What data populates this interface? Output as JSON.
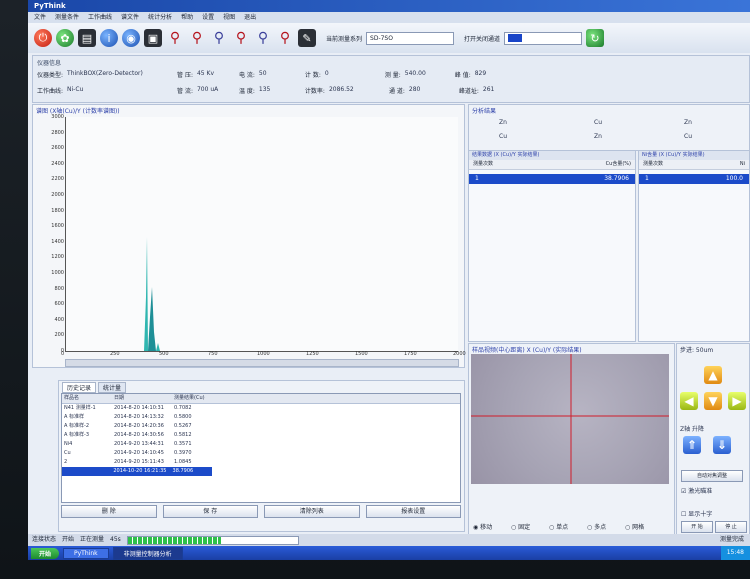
{
  "window": {
    "title": "PyThink"
  },
  "menu": [
    "文件",
    "测量条件",
    "工作曲线",
    "谱文件",
    "统计分析",
    "帮助",
    "设置",
    "视图",
    "退出"
  ],
  "toolbar": {
    "icons": [
      "power-icon",
      "gear-icon",
      "print-icon",
      "info-icon",
      "save-icon",
      "zoom-fit-icon",
      "zoom-in-icon",
      "zoom-out-icon",
      "zoom-reset-icon",
      "zoom-area-icon",
      "zoom-full-icon",
      "tool-icon"
    ],
    "measure_series_label": "当前测量系列",
    "measure_series_value": "SD-7SO",
    "open_close_label": "打开关闭通道",
    "refresh_icon": "refresh-icon"
  },
  "info": {
    "group_title": "仪器信息",
    "row1": [
      {
        "l": "仪器类型:",
        "v": "ThinkBOX(Zero-Detector)"
      },
      {
        "l": "管  压:",
        "v": "45 Kv"
      },
      {
        "l": "电  流:",
        "v": "50"
      },
      {
        "l": "计 数:",
        "v": "0"
      },
      {
        "l": "测  量:",
        "v": "540.00"
      },
      {
        "l": "峰  值:",
        "v": "829"
      }
    ],
    "row2": [
      {
        "l": "工作曲线:",
        "v": "Ni-Cu"
      },
      {
        "l": "管  流:",
        "v": "700 uA"
      },
      {
        "l": "温  度:",
        "v": "135"
      },
      {
        "l": "计数率:",
        "v": "2086.52"
      },
      {
        "l": "通  道:",
        "v": "280"
      },
      {
        "l": "峰道址:",
        "v": "261"
      }
    ]
  },
  "spectrum": {
    "caption": "谱图 (X轴(Cu)/Y (计数率谱图))",
    "yticks": [
      "3000",
      "2800",
      "2600",
      "2400",
      "2200",
      "2000",
      "1800",
      "1600",
      "1400",
      "1200",
      "1000",
      "800",
      "600",
      "400",
      "200",
      "0"
    ],
    "xticks": [
      "0",
      "250",
      "500",
      "750",
      "1000",
      "1250",
      "1500",
      "1750",
      "2000"
    ]
  },
  "elements": {
    "title": "分析结果",
    "items": [
      "Zn",
      "Cu",
      "Zn",
      "Cu",
      "Zn",
      "Cu"
    ]
  },
  "result_left": {
    "title": "结果数据 (X (Cu)/Y 实际结果)",
    "col1": "测量次数",
    "col2": "Cu含量(%)",
    "row": {
      "n": "1",
      "v": "38.7906"
    }
  },
  "result_right": {
    "title": "Ni含量 (X (Cu)/Y 实际结果)",
    "col1": "测量次数",
    "col2": "Ni",
    "row": {
      "n": "1",
      "v": "100.0"
    }
  },
  "history": {
    "tabs": [
      "历史记录",
      "统计量"
    ],
    "headers": [
      "样品名",
      "日期",
      "测量结果(Cu)"
    ],
    "rows": [
      {
        "a": "N41 测量样-1",
        "b": "2014-8-20 14:10:31",
        "c": "0.7082"
      },
      {
        "a": "A 标准样",
        "b": "2014-8-20 14:13:32",
        "c": "0.5800"
      },
      {
        "a": "A 标准样-2",
        "b": "2014-8-20 14:20:36",
        "c": "0.5267"
      },
      {
        "a": "A 标准样-3",
        "b": "2014-8-20 14:30:56",
        "c": "0.5812"
      },
      {
        "a": "Ni4",
        "b": "2014-9-20 13:44:31",
        "c": "0.3571"
      },
      {
        "a": "Cu",
        "b": "2014-9-20 14:10:45",
        "c": "0.3970"
      },
      {
        "a": "2",
        "b": "2014-9-20 15:11:43",
        "c": "1.0845"
      },
      {
        "a": "",
        "b": "2014-10-20 16:21:35",
        "c": "38.7906"
      }
    ],
    "buttons": [
      "删 除",
      "保 存",
      "清除列表",
      "报表设置"
    ]
  },
  "camera": {
    "title": "样品视频(中心距离) X (Cu)/Y (实际结果)",
    "radio": [
      "移动",
      "固定",
      "单点",
      "多点",
      "网格"
    ]
  },
  "controls": {
    "title": "步进: 50um",
    "title2": "Z轴 升降",
    "auto_focus": "自动对焦调整",
    "focus_check": "激光瞄准",
    "check2": "显示十字",
    "bottom_buttons": [
      "开 始",
      "停 止"
    ]
  },
  "status": {
    "label": "连接状态",
    "left_vals": [
      "开始",
      "正在测量",
      "45s"
    ],
    "progress": 0.55,
    "right": "测量完成"
  },
  "taskbar": {
    "start": "开始",
    "tasks": [
      "PyThink",
      "非测量控制器分析"
    ],
    "clock": "15:48"
  },
  "colors": {
    "accent": "#1c4bc9",
    "spectrum_peak": "#2fb6b0"
  }
}
